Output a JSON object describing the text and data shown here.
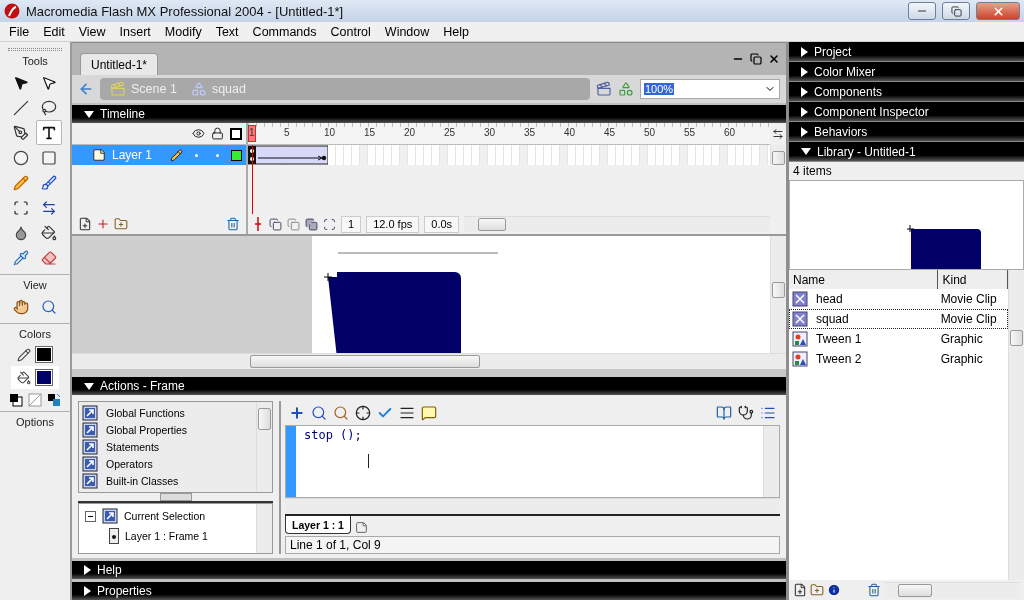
{
  "window": {
    "title": "Macromedia Flash MX Professional 2004 - [Untitled-1*]"
  },
  "menu": [
    "File",
    "Edit",
    "View",
    "Insert",
    "Modify",
    "Text",
    "Commands",
    "Control",
    "Window",
    "Help"
  ],
  "tools": {
    "title": "Tools",
    "view_title": "View",
    "colors_title": "Colors",
    "options_title": "Options",
    "items": [
      {
        "kind": "arrow",
        "selected": false
      },
      {
        "kind": "subselect",
        "selected": false
      },
      {
        "kind": "line",
        "selected": false
      },
      {
        "kind": "lasso",
        "selected": false
      },
      {
        "kind": "pen",
        "selected": false
      },
      {
        "kind": "text",
        "selected": true
      },
      {
        "kind": "oval",
        "selected": false
      },
      {
        "kind": "rectangle",
        "selected": false
      },
      {
        "kind": "pencil",
        "selected": false
      },
      {
        "kind": "brush",
        "selected": false
      },
      {
        "kind": "transform",
        "selected": false
      },
      {
        "kind": "gradient",
        "selected": false
      },
      {
        "kind": "inkbottle",
        "selected": false
      },
      {
        "kind": "paintbucket",
        "selected": false
      },
      {
        "kind": "dropper",
        "selected": false
      },
      {
        "kind": "eraser",
        "selected": false
      }
    ],
    "view_items": [
      {
        "kind": "hand",
        "selected": false
      },
      {
        "kind": "zoom",
        "selected": false
      }
    ],
    "colors": [
      {
        "kind": "stroke",
        "color": "#000000"
      },
      {
        "kind": "fill",
        "color": "#000066"
      }
    ]
  },
  "document": {
    "tab": "Untitled-1*",
    "breadcrumbs": [
      {
        "kind": "scene",
        "label": "Scene 1"
      },
      {
        "kind": "symbol",
        "label": "squad"
      }
    ],
    "zoom": "100%"
  },
  "timeline": {
    "title": "Timeline",
    "expanded": true,
    "ruler": [
      "1",
      "5",
      "10",
      "15",
      "20",
      "25",
      "30",
      "35",
      "40",
      "45",
      "50",
      "55",
      "60"
    ],
    "layers": [
      {
        "name": "Layer 1",
        "selected": true,
        "color": "#33ee33"
      }
    ],
    "frame": "1",
    "fps": "12.0 fps",
    "time": "0.0s"
  },
  "actions": {
    "title": "Actions - Frame",
    "expanded": true,
    "toolbox": [
      "Global Functions",
      "Global Properties",
      "Statements",
      "Operators",
      "Built-in Classes"
    ],
    "tree": {
      "label": "Current Selection",
      "expanded": true,
      "children": [
        {
          "label": "Layer 1 : Frame 1"
        }
      ]
    },
    "code": "stop ();",
    "script_tab": "Layer 1 : 1",
    "status": "Line 1 of 1, Col 9"
  },
  "bottom_panels": [
    {
      "title": "Help",
      "expanded": false
    },
    {
      "title": "Properties",
      "expanded": false
    }
  ],
  "dock_panels": [
    {
      "title": "Project",
      "expanded": false
    },
    {
      "title": "Color Mixer",
      "expanded": false
    },
    {
      "title": "Components",
      "expanded": false
    },
    {
      "title": "Component Inspector",
      "expanded": false
    },
    {
      "title": "Behaviors",
      "expanded": false
    }
  ],
  "library": {
    "title": "Library - Untitled-1",
    "expanded": true,
    "count": "4 items",
    "columns": [
      "Name",
      "Kind"
    ],
    "items": [
      {
        "name": "head",
        "symbol_type": "Movie Clip",
        "kind": "movieclip",
        "selected": false
      },
      {
        "name": "squad",
        "symbol_type": "Movie Clip",
        "kind": "movieclip",
        "selected": true
      },
      {
        "name": "Tween 1",
        "symbol_type": "Graphic",
        "kind": "graphic",
        "selected": false
      },
      {
        "name": "Tween 2",
        "symbol_type": "Graphic",
        "kind": "graphic",
        "selected": false
      }
    ]
  }
}
